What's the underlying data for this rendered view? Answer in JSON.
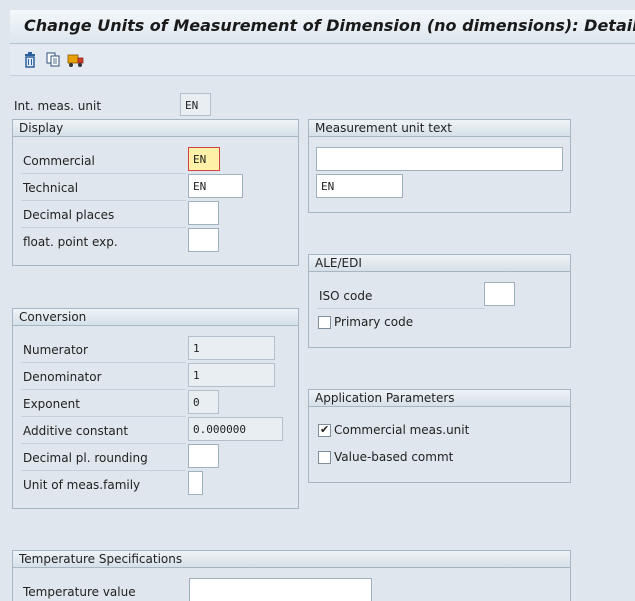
{
  "window": {
    "title": "Change Units of Measurement of Dimension (no dimensions): Details"
  },
  "toolbar": {
    "icons": [
      "trash-icon",
      "copy-icon",
      "transport-icon"
    ]
  },
  "header": {
    "int_meas_label": "Int. meas. unit",
    "int_meas_value": "EN"
  },
  "display": {
    "title": "Display",
    "commercial_label": "Commercial",
    "commercial_value": "EN",
    "technical_label": "Technical",
    "technical_value": "EN",
    "decimal_places_label": "Decimal places",
    "decimal_places_value": "",
    "float_exp_label": "float. point exp.",
    "float_exp_value": ""
  },
  "meas_text": {
    "title": "Measurement unit text",
    "long_text_value": "",
    "short_text_value": "EN"
  },
  "ale_edi": {
    "title": "ALE/EDI",
    "iso_code_label": "ISO code",
    "iso_code_value": "",
    "primary_code_label": "Primary code",
    "primary_code_checked": false
  },
  "conversion": {
    "title": "Conversion",
    "numerator_label": "Numerator",
    "numerator_value": "1",
    "denominator_label": "Denominator",
    "denominator_value": "1",
    "exponent_label": "Exponent",
    "exponent_value": "0",
    "additive_label": "Additive constant",
    "additive_value": "0.000000",
    "rounding_label": "Decimal pl. rounding",
    "rounding_value": "",
    "family_label": "Unit of meas.family",
    "family_value": ""
  },
  "app_params": {
    "title": "Application Parameters",
    "commercial_label": "Commercial meas.unit",
    "commercial_checked": true,
    "value_based_label": "Value-based commt",
    "value_based_checked": false
  },
  "temperature": {
    "title": "Temperature Specifications",
    "value_label": "Temperature value",
    "value": ""
  },
  "colors": {
    "background": "#dfe6ed",
    "focus_field": "#fff2a8",
    "focus_border": "#d34242"
  }
}
